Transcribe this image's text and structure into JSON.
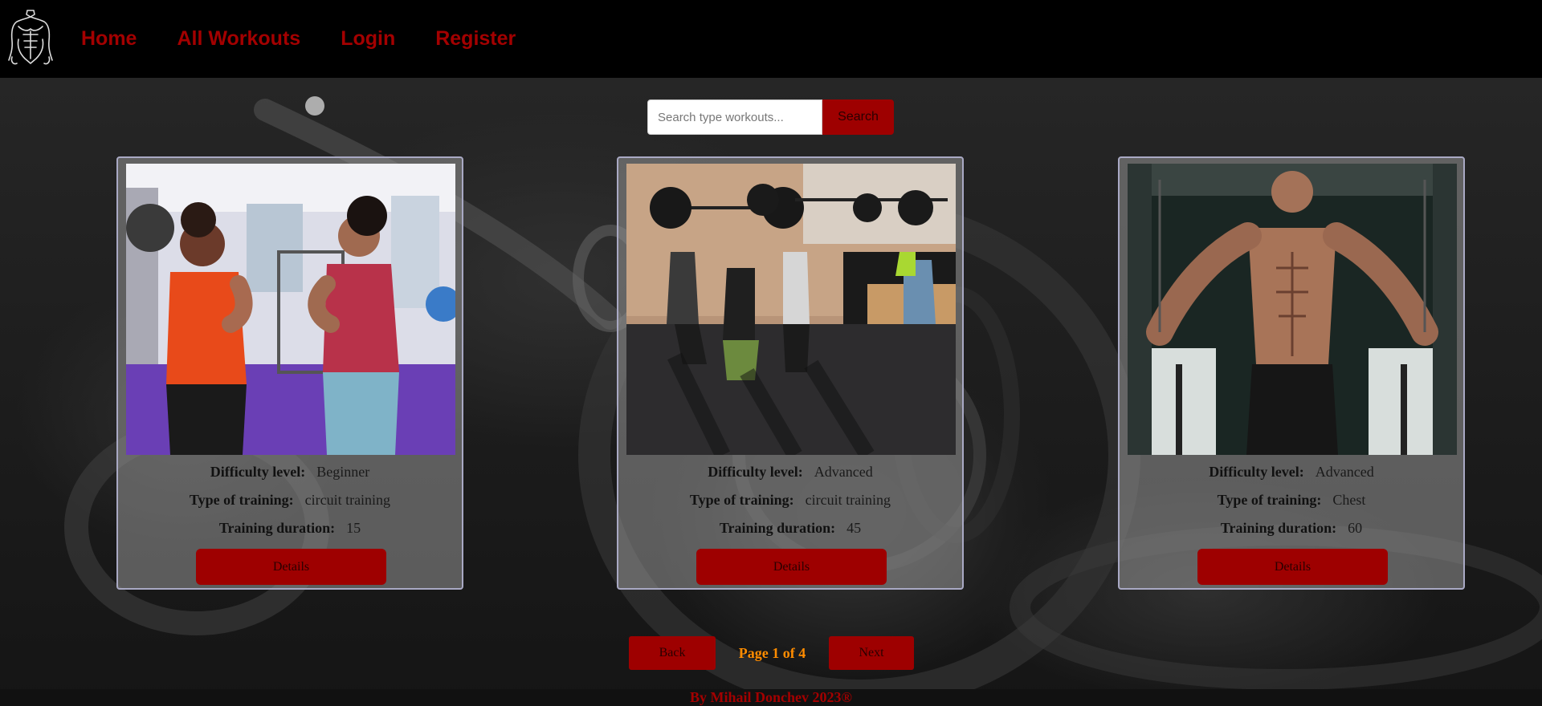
{
  "nav": {
    "logo_icon": "bodybuilder-logo-icon",
    "links": [
      {
        "label": "Home"
      },
      {
        "label": "All Workouts"
      },
      {
        "label": "Login"
      },
      {
        "label": "Register"
      }
    ]
  },
  "search": {
    "placeholder": "Search type workouts...",
    "value": "",
    "button_label": "Search"
  },
  "labels": {
    "difficulty": "Difficulty level:",
    "type": "Type of training:",
    "duration": "Training duration:",
    "details": "Details"
  },
  "workouts": [
    {
      "difficulty": "Beginner",
      "type": "circuit training",
      "duration": "15",
      "image": "two-women-boxing-gym-photo"
    },
    {
      "difficulty": "Advanced",
      "type": "circuit training",
      "duration": "45",
      "image": "group-overhead-squat-barbell-photo"
    },
    {
      "difficulty": "Advanced",
      "type": "Chest",
      "duration": "60",
      "image": "bodybuilder-cable-crossover-photo"
    }
  ],
  "pagination": {
    "back_label": "Back",
    "page_text": "Page 1 of 4",
    "next_label": "Next"
  },
  "footer": {
    "text": "By Mihail Donchev 2023®"
  },
  "colors": {
    "accent": "#9e0000",
    "nav_text": "#a30000",
    "page_indicator": "#ff8c00",
    "card_border": "#a9a9c4"
  }
}
